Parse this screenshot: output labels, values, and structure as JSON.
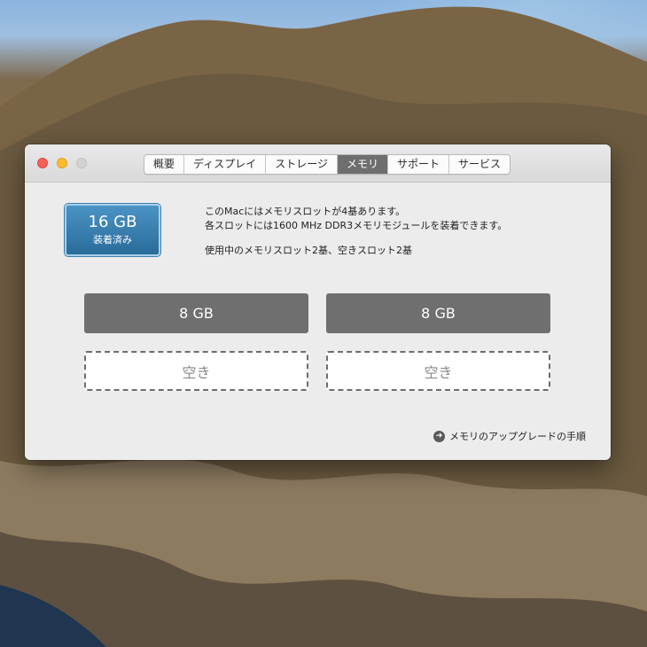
{
  "window": {
    "tabs": [
      {
        "label": "概要"
      },
      {
        "label": "ディスプレイ"
      },
      {
        "label": "ストレージ"
      },
      {
        "label": "メモリ"
      },
      {
        "label": "サポート"
      },
      {
        "label": "サービス"
      }
    ],
    "active_tab": "メモリ"
  },
  "memory": {
    "total": "16 GB",
    "status": "装着済み",
    "info_line1": "このMacにはメモリスロットが4基あります。",
    "info_line2": "各スロットには1600 MHz DDR3メモリモジュールを装着できます。",
    "info_line3": "使用中のメモリスロット2基、空きスロット2基",
    "slots": [
      {
        "label": "8 GB",
        "filled": true
      },
      {
        "label": "8 GB",
        "filled": true
      },
      {
        "label": "空き",
        "filled": false
      },
      {
        "label": "空き",
        "filled": false
      }
    ],
    "upgrade_link": "メモリのアップグレードの手順"
  },
  "icons": {
    "upgrade_link_icon": "arrow-right-circle-icon"
  },
  "colors": {
    "badge": "#2f74a4",
    "slot_filled": "#6f6f6f",
    "active_tab": "#6e6e6e",
    "close": "#fc5f57",
    "minimize": "#fdbc2e",
    "zoom": "#d3d3d3"
  }
}
